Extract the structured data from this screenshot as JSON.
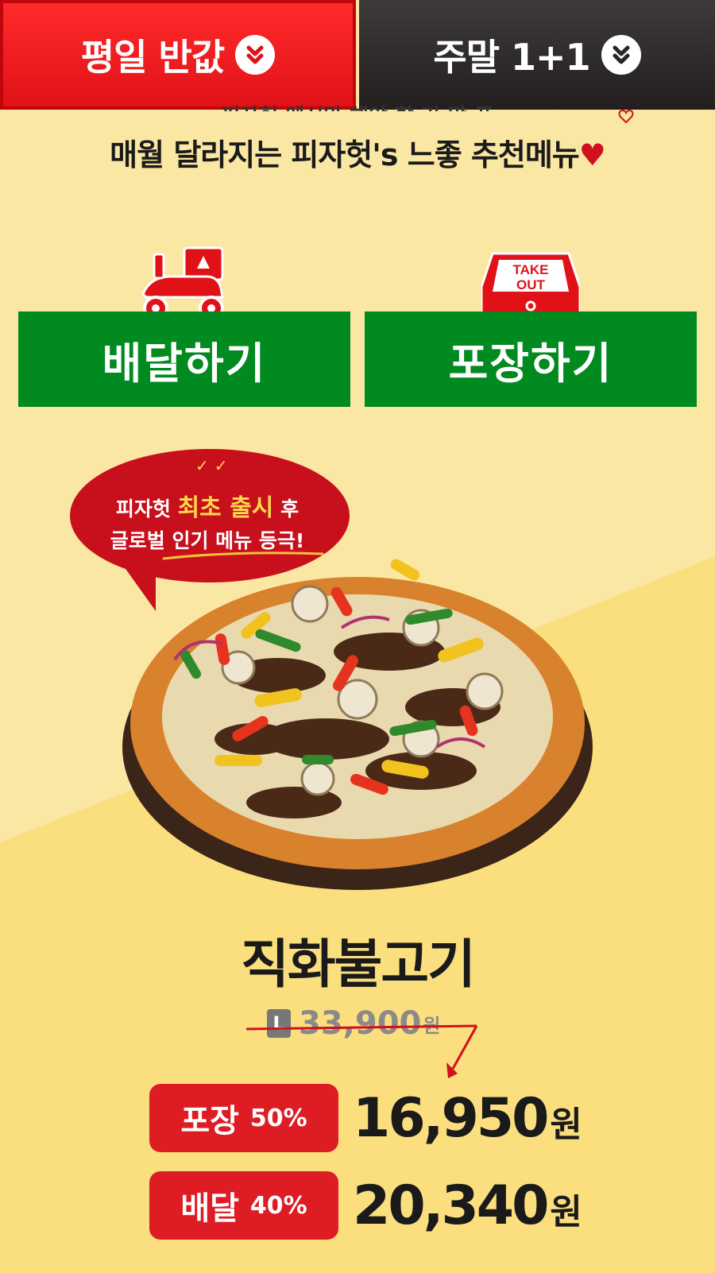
{
  "tabs": [
    {
      "label": "평일 반값",
      "active": true
    },
    {
      "label": "주말 1+1",
      "active": false
    }
  ],
  "subheadline_clipped": "피자헛 에서만 해야 할 거.맛.픈",
  "headline": "매월 달라지는 피자헛's 느좋 추천메뉴",
  "actions": {
    "delivery_label": "배달하기",
    "takeout_label": "포장하기",
    "takeout_box_text": [
      "TAKE",
      "OUT"
    ]
  },
  "promo_bubble": {
    "line1_prefix": "피자헛 ",
    "line1_highlight": "최초 출시",
    "line1_suffix": " 후",
    "line2": "글로벌 인기 메뉴 등극!"
  },
  "product": {
    "name": "직화불고기",
    "size": "L",
    "original_price": "33,900",
    "currency": "원"
  },
  "prices": [
    {
      "label": "포장",
      "discount": "50%",
      "amount": "16,950",
      "currency": "원"
    },
    {
      "label": "배달",
      "discount": "40%",
      "amount": "20,340",
      "currency": "원"
    }
  ],
  "colors": {
    "brand_red": "#dd1c24",
    "action_green": "#008a1f",
    "background": "#fbe7a4"
  }
}
